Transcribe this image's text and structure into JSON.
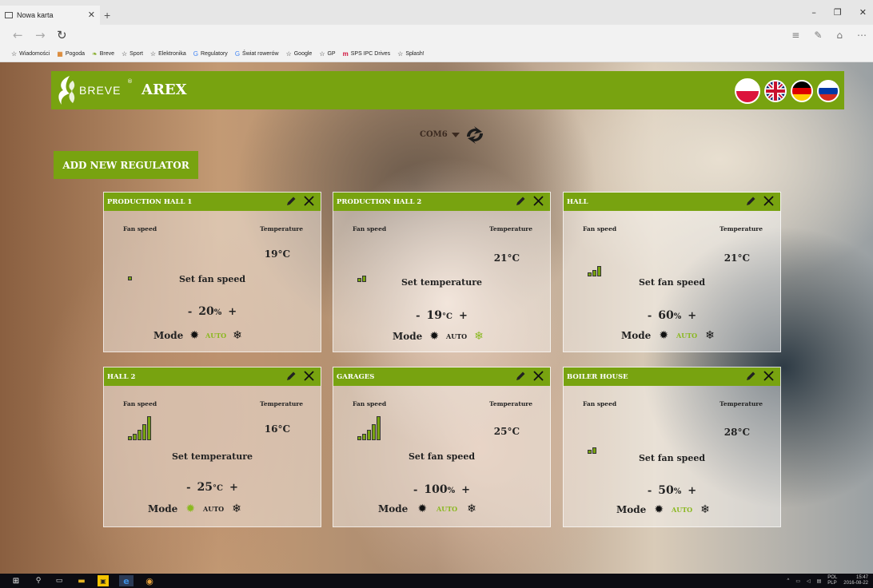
{
  "browser": {
    "tab_title": "Nowa karta",
    "bookmarks": [
      {
        "label": "Wiadomości",
        "icon": "star-icon"
      },
      {
        "label": "Pogoda",
        "icon": "weather-icon"
      },
      {
        "label": "Breve",
        "icon": "breve-icon"
      },
      {
        "label": "Sport",
        "icon": "star-icon"
      },
      {
        "label": "Elektronika",
        "icon": "star-icon"
      },
      {
        "label": "Regulatory",
        "icon": "google-icon"
      },
      {
        "label": "Świat rowerów",
        "icon": "google-icon"
      },
      {
        "label": "Google",
        "icon": "star-icon"
      },
      {
        "label": "GP",
        "icon": "star-icon"
      },
      {
        "label": "SPS IPC Drives",
        "icon": "m-icon"
      },
      {
        "label": "Splash!",
        "icon": "star-icon"
      }
    ]
  },
  "header": {
    "logo_text": "BREVE",
    "logo_reg": "®",
    "app_title": "AREX",
    "languages": [
      "pl",
      "en",
      "de",
      "ru"
    ]
  },
  "port": {
    "label": "COM6"
  },
  "add_button": {
    "label": "ADD NEW REGULATOR"
  },
  "labels": {
    "fan_speed": "Fan speed",
    "temperature": "Temperature",
    "mode": "Mode",
    "auto": "AUTO"
  },
  "colors": {
    "accent": "#78a310",
    "active_mode": "#8ab820"
  },
  "regulators": [
    {
      "name": "PRODUCTION HALL  1",
      "fan_level": 1,
      "temperature": "19°C",
      "set_label": "Set fan speed",
      "set_value": "20",
      "set_unit": "%",
      "active_mode": "auto"
    },
    {
      "name": "PRODUCTION HALL 2",
      "fan_level": 2,
      "temperature": "21°C",
      "set_label": "Set temperature",
      "set_value": "19",
      "set_unit": "°C",
      "active_mode": "cool"
    },
    {
      "name": "HALL",
      "fan_level": 3,
      "temperature": "21°C",
      "set_label": "Set fan speed",
      "set_value": "60",
      "set_unit": "%",
      "active_mode": "auto"
    },
    {
      "name": "HALL 2",
      "fan_level": 5,
      "temperature": "16°C",
      "set_label": "Set temperature",
      "set_value": "25",
      "set_unit": "°C",
      "active_mode": "heat"
    },
    {
      "name": "GARAGES",
      "fan_level": 5,
      "temperature": "25°C",
      "set_label": "Set fan speed",
      "set_value": "100",
      "set_unit": "%",
      "active_mode": "auto"
    },
    {
      "name": "BOILER HOUSE",
      "fan_level": 2,
      "temperature": "28°C",
      "set_label": "Set fan speed",
      "set_value": "50",
      "set_unit": "%",
      "active_mode": "auto"
    }
  ],
  "taskbar": {
    "lang": "POL",
    "lang2": "PLP",
    "time": "15:47",
    "date": "2016-08-22"
  }
}
